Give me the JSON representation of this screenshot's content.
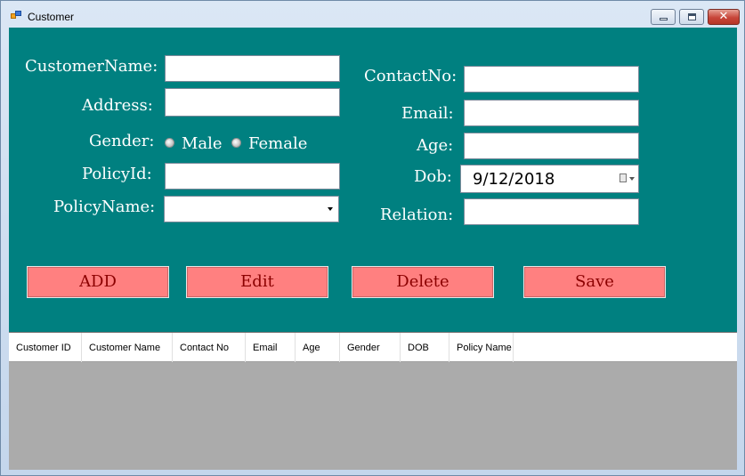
{
  "window": {
    "title": "Customer",
    "close_glyph": "✕"
  },
  "form": {
    "customer_name_label": "CustomerName:",
    "address_label": "Address:",
    "gender_label": "Gender:",
    "gender_options": [
      "Male",
      "Female"
    ],
    "policy_id_label": "PolicyId:",
    "policy_name_label": "PolicyName:",
    "contact_no_label": "ContactNo:",
    "email_label": "Email:",
    "age_label": "Age:",
    "dob_label": "Dob:",
    "dob_value": "9/12/2018",
    "relation_label": "Relation:"
  },
  "buttons": {
    "add": "ADD",
    "edit": "Edit",
    "delete": "Delete",
    "save": "Save"
  },
  "grid": {
    "columns": [
      "Customer ID",
      "Customer Name",
      "Contact No",
      "Email",
      "Age",
      "Gender",
      "DOB",
      "Policy Name"
    ]
  },
  "colors": {
    "form_background": "#008080",
    "button_background": "#FF8080",
    "button_text": "#8B0000",
    "grid_background": "#ABABAB"
  }
}
